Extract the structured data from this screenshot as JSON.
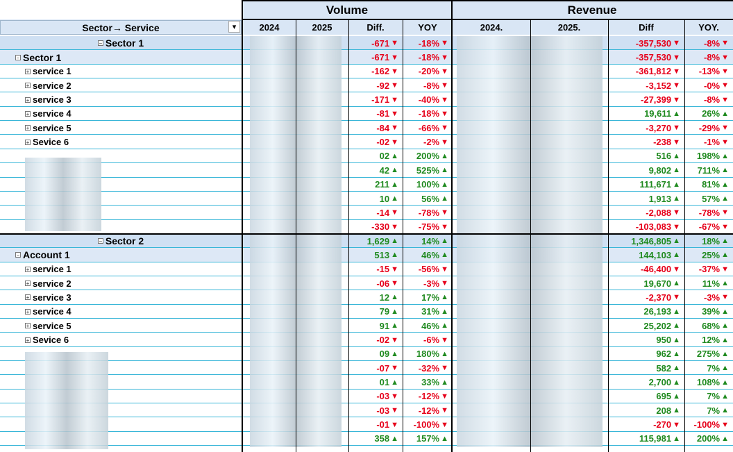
{
  "header": {
    "row_field_label": "Sector→ Service",
    "groups": [
      "Volume",
      "Revenue"
    ],
    "columns": [
      "2024",
      "2025",
      "Diff.",
      "YOY",
      "2024.",
      "2025.",
      "Diff",
      "YOY."
    ]
  },
  "colors": {
    "negative": "#e6001a",
    "positive": "#1f8a1f",
    "header_bg": "#d9e6f5",
    "gridline": "#38b6d8"
  },
  "rows": [
    {
      "label": "Sector 1",
      "kind": "sector",
      "vol_diff": "-671",
      "vol_yoy": "-18%",
      "rev_diff": "-357,530",
      "rev_yoy": "-8%"
    },
    {
      "label": "Sector 1",
      "kind": "sub",
      "vol_diff": "-671",
      "vol_yoy": "-18%",
      "rev_diff": "-357,530",
      "rev_yoy": "-8%"
    },
    {
      "label": "service 1",
      "kind": "item",
      "vol_diff": "-162",
      "vol_yoy": "-20%",
      "rev_diff": "-361,812",
      "rev_yoy": "-13%"
    },
    {
      "label": "service 2",
      "kind": "item",
      "vol_diff": "-92",
      "vol_yoy": "-8%",
      "rev_diff": "-3,152",
      "rev_yoy": "-0%"
    },
    {
      "label": "service 3",
      "kind": "item",
      "vol_diff": "-171",
      "vol_yoy": "-40%",
      "rev_diff": "-27,399",
      "rev_yoy": "-8%"
    },
    {
      "label": "service 4",
      "kind": "item",
      "vol_diff": "-81",
      "vol_yoy": "-18%",
      "rev_diff": "19,611",
      "rev_yoy": "26%"
    },
    {
      "label": "service 5",
      "kind": "item",
      "vol_diff": "-84",
      "vol_yoy": "-66%",
      "rev_diff": "-3,270",
      "rev_yoy": "-29%"
    },
    {
      "label": "Sevice 6",
      "kind": "item",
      "vol_diff": "-02",
      "vol_yoy": "-2%",
      "rev_diff": "-238",
      "rev_yoy": "-1%"
    },
    {
      "label": "",
      "kind": "hidden",
      "vol_diff": "02",
      "vol_yoy": "200%",
      "rev_diff": "516",
      "rev_yoy": "198%"
    },
    {
      "label": "",
      "kind": "hidden",
      "vol_diff": "42",
      "vol_yoy": "525%",
      "rev_diff": "9,802",
      "rev_yoy": "711%"
    },
    {
      "label": "",
      "kind": "hidden",
      "vol_diff": "211",
      "vol_yoy": "100%",
      "rev_diff": "111,671",
      "rev_yoy": "81%"
    },
    {
      "label": "",
      "kind": "hidden",
      "vol_diff": "10",
      "vol_yoy": "56%",
      "rev_diff": "1,913",
      "rev_yoy": "57%"
    },
    {
      "label": "",
      "kind": "hidden",
      "vol_diff": "-14",
      "vol_yoy": "-78%",
      "rev_diff": "-2,088",
      "rev_yoy": "-78%"
    },
    {
      "label": "",
      "kind": "hidden",
      "vol_diff": "-330",
      "vol_yoy": "-75%",
      "rev_diff": "-103,083",
      "rev_yoy": "-67%"
    },
    {
      "label": "Sector 2",
      "kind": "sector",
      "vol_diff": "1,629",
      "vol_yoy": "14%",
      "rev_diff": "1,346,805",
      "rev_yoy": "18%"
    },
    {
      "label": "Account 1",
      "kind": "sub",
      "vol_diff": "513",
      "vol_yoy": "46%",
      "rev_diff": "144,103",
      "rev_yoy": "25%"
    },
    {
      "label": "service 1",
      "kind": "item",
      "vol_diff": "-15",
      "vol_yoy": "-56%",
      "rev_diff": "-46,400",
      "rev_yoy": "-37%"
    },
    {
      "label": "service 2",
      "kind": "item",
      "vol_diff": "-06",
      "vol_yoy": "-3%",
      "rev_diff": "19,670",
      "rev_yoy": "11%"
    },
    {
      "label": "service 3",
      "kind": "item",
      "vol_diff": "12",
      "vol_yoy": "17%",
      "rev_diff": "-2,370",
      "rev_yoy": "-3%"
    },
    {
      "label": "service 4",
      "kind": "item",
      "vol_diff": "79",
      "vol_yoy": "31%",
      "rev_diff": "26,193",
      "rev_yoy": "39%"
    },
    {
      "label": "service 5",
      "kind": "item",
      "vol_diff": "91",
      "vol_yoy": "46%",
      "rev_diff": "25,202",
      "rev_yoy": "68%"
    },
    {
      "label": "Sevice 6",
      "kind": "item",
      "vol_diff": "-02",
      "vol_yoy": "-6%",
      "rev_diff": "950",
      "rev_yoy": "12%"
    },
    {
      "label": "",
      "kind": "hidden",
      "vol_diff": "09",
      "vol_yoy": "180%",
      "rev_diff": "962",
      "rev_yoy": "275%"
    },
    {
      "label": "",
      "kind": "hidden",
      "vol_diff": "-07",
      "vol_yoy": "-32%",
      "rev_diff": "582",
      "rev_yoy": "7%"
    },
    {
      "label": "",
      "kind": "hidden",
      "vol_diff": "01",
      "vol_yoy": "33%",
      "rev_diff": "2,700",
      "rev_yoy": "108%"
    },
    {
      "label": "",
      "kind": "hidden",
      "vol_diff": "-03",
      "vol_yoy": "-12%",
      "rev_diff": "695",
      "rev_yoy": "7%"
    },
    {
      "label": "",
      "kind": "hidden",
      "vol_diff": "-03",
      "vol_yoy": "-12%",
      "rev_diff": "208",
      "rev_yoy": "7%"
    },
    {
      "label": "",
      "kind": "hidden",
      "vol_diff": "-01",
      "vol_yoy": "-100%",
      "rev_diff": "-270",
      "rev_yoy": "-100%"
    },
    {
      "label": "",
      "kind": "hidden",
      "vol_diff": "358",
      "vol_yoy": "157%",
      "rev_diff": "115,981",
      "rev_yoy": "200%"
    }
  ],
  "icons": {
    "filter": "sort-filter-icon",
    "expand": "expand-icon",
    "collapse": "collapse-icon",
    "down": "down-arrow-icon",
    "up": "up-arrow-icon"
  }
}
